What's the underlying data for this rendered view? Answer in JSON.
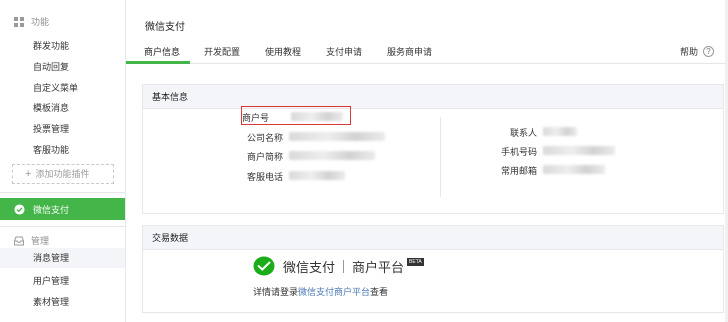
{
  "sidebar": {
    "section_features": "功能",
    "feature_items": [
      "群发功能",
      "自动回复",
      "自定义菜单",
      "模板消息",
      "投票管理",
      "客服功能"
    ],
    "add_plugin": "添加功能插件",
    "wechat_pay": "微信支付",
    "section_manage": "管理",
    "manage_items": [
      "消息管理",
      "用户管理",
      "素材管理"
    ]
  },
  "main": {
    "title": "微信支付",
    "tabs": [
      "商户信息",
      "开发配置",
      "使用教程",
      "支付申请",
      "服务商申请"
    ],
    "help": "帮助",
    "basic_info": {
      "heading": "基本信息",
      "left_labels": [
        "商户号",
        "公司名称",
        "商户简称",
        "客服电话"
      ],
      "right_labels": [
        "联系人",
        "手机号码",
        "常用邮箱"
      ]
    },
    "trade": {
      "heading": "交易数据",
      "logo_left": "微信支付",
      "logo_right": "商户平台",
      "beta": "BETA",
      "desc_prefix": "详情请登录",
      "desc_link": "微信支付商户平台",
      "desc_suffix": "查看"
    }
  },
  "colors": {
    "accent": "#44b549",
    "link": "#4a78b5",
    "highlight": "#d9383b"
  }
}
